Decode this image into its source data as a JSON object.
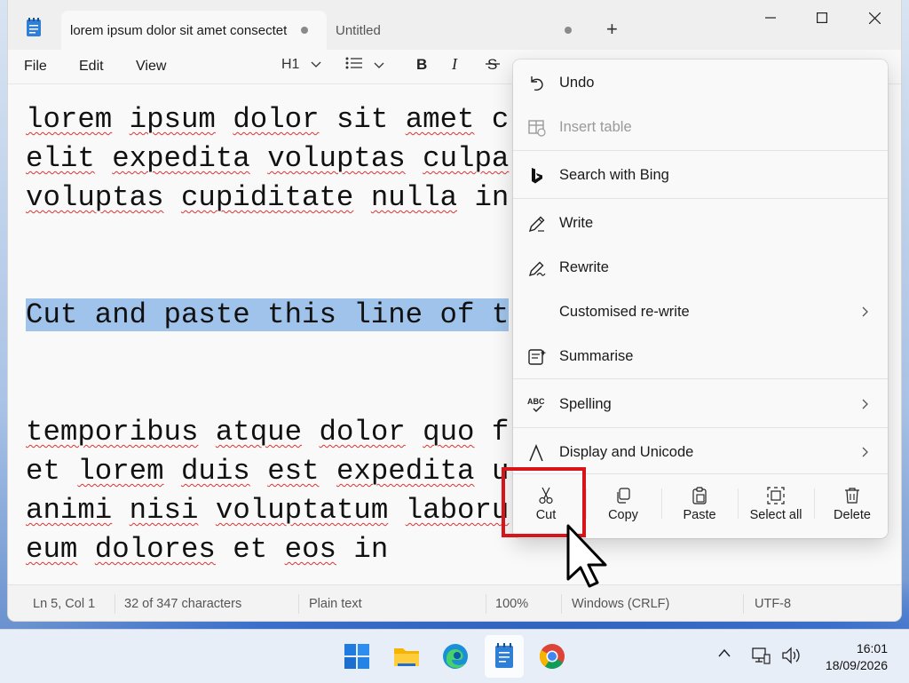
{
  "window": {
    "tabs": [
      {
        "label": "lorem ipsum dolor sit amet consectetur",
        "active": true
      },
      {
        "label": "Untitled",
        "active": false
      }
    ],
    "new_tab_symbol": "+"
  },
  "menubar": {
    "file": "File",
    "edit": "Edit",
    "view": "View",
    "heading_selector": "H1"
  },
  "editor": {
    "lines": [
      "lorem ipsum dolor sit amet c",
      "elit expedita voluptas culpa",
      "voluptas cupiditate nulla in",
      "Cut and paste this line of t",
      "temporibus atque dolor quo f",
      "et lorem duis est expedita u",
      "animi nisi voluptatum laboru",
      "eum dolores et eos in"
    ]
  },
  "status": {
    "position": "Ln 5, Col 1",
    "chars": "32 of 347 characters",
    "format": "Plain text",
    "zoom": "100%",
    "line_endings": "Windows (CRLF)",
    "encoding": "UTF-8"
  },
  "context_menu": {
    "undo": "Undo",
    "insert_table": "Insert table",
    "search_bing": "Search with Bing",
    "write": "Write",
    "rewrite": "Rewrite",
    "custom_rewrite": "Customised re-write",
    "summarise": "Summarise",
    "spelling": "Spelling",
    "display_unicode": "Display and Unicode",
    "quick_actions": {
      "cut": "Cut",
      "copy": "Copy",
      "paste": "Paste",
      "select_all": "Select all",
      "delete": "Delete"
    }
  },
  "taskbar": {
    "time": "16:01",
    "date": "18/09/2026",
    "icons": [
      "windows-start-icon",
      "file-explorer-icon",
      "edge-icon",
      "notepad-icon",
      "chrome-icon"
    ]
  },
  "colors": {
    "selection": "#9fc3ea",
    "highlight_box": "#d7141a",
    "spellcheck": "#dd3333"
  }
}
